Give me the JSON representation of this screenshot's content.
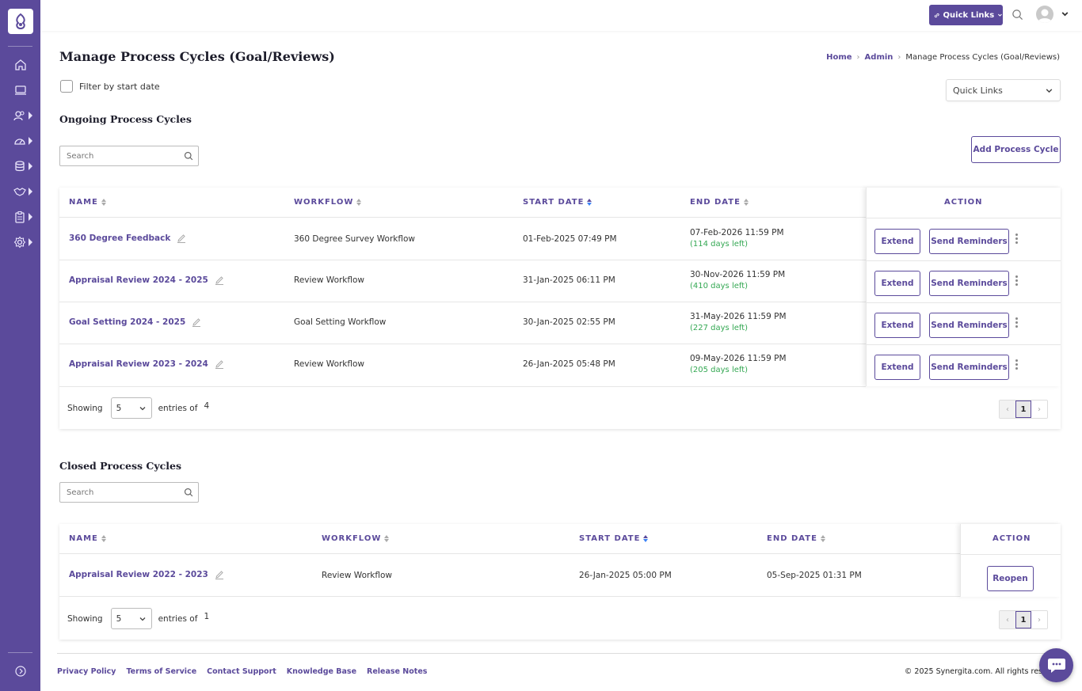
{
  "topbar": {
    "quick_links_label": "Quick Links"
  },
  "header": {
    "title": "Manage Process Cycles (Goal/Reviews)",
    "breadcrumb": [
      "Home",
      "Admin",
      "Manage Process Cycles (Goal/Reviews)"
    ]
  },
  "filter": {
    "label": "Filter by start date",
    "checked": false
  },
  "quick_links_select": {
    "selected": "Quick Links"
  },
  "ongoing": {
    "title": "Ongoing Process Cycles",
    "search_placeholder": "Search",
    "add_button": "Add Process Cycle",
    "columns": [
      "NAME",
      "WORKFLOW",
      "START DATE",
      "END DATE",
      "ACTION"
    ],
    "rows": [
      {
        "name": "360 Degree Feedback",
        "workflow": "360 Degree Survey Workflow",
        "start": "01-Feb-2025 07:49 PM",
        "end": "07-Feb-2026 11:59 PM",
        "left": "(114 days left)"
      },
      {
        "name": "Appraisal Review 2024 - 2025",
        "workflow": "Review Workflow",
        "start": "31-Jan-2025 06:11 PM",
        "end": "30-Nov-2026 11:59 PM",
        "left": "(410 days left)"
      },
      {
        "name": "Goal Setting 2024 - 2025",
        "workflow": "Goal Setting Workflow",
        "start": "30-Jan-2025 02:55 PM",
        "end": "31-May-2026 11:59 PM",
        "left": "(227 days left)"
      },
      {
        "name": "Appraisal Review 2023 - 2024",
        "workflow": "Review Workflow",
        "start": "26-Jan-2025 05:48 PM",
        "end": "09-May-2026 11:59 PM",
        "left": "(205 days left)"
      }
    ],
    "extend_label": "Extend",
    "remind_label": "Send Reminders",
    "showing": "Showing",
    "page_size": "5",
    "entries_of": "entries of",
    "total": "4",
    "page": "1",
    "prev": "‹",
    "next": "›"
  },
  "closed": {
    "title": "Closed Process Cycles",
    "search_placeholder": "Search",
    "columns": [
      "NAME",
      "WORKFLOW",
      "START DATE",
      "END DATE",
      "ACTION"
    ],
    "rows": [
      {
        "name": "Appraisal Review 2022 - 2023",
        "workflow": "Review Workflow",
        "start": "26-Jan-2025 05:00 PM",
        "end": "05-Sep-2025 01:31 PM"
      }
    ],
    "reopen_label": "Reopen",
    "showing": "Showing",
    "page_size": "5",
    "entries_of": "entries of",
    "total": "1",
    "page": "1",
    "prev": "‹",
    "next": "›"
  },
  "footer": {
    "links": [
      "Privacy Policy",
      "Terms of Service",
      "Contact Support",
      "Knowledge Base",
      "Release Notes"
    ],
    "copyright": "© 2025 Synergita.com. All rights res"
  },
  "colors": {
    "brand": "#5b4a9b",
    "days_left": "#34a853"
  }
}
